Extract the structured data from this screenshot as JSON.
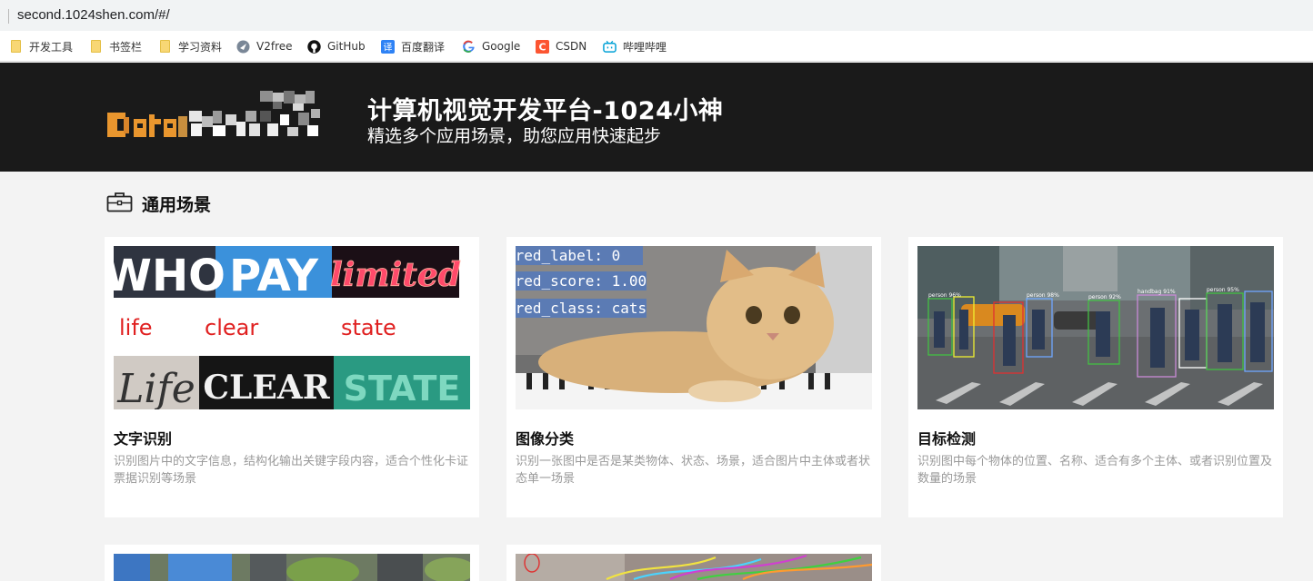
{
  "browser": {
    "url": "second.1024shen.com/#/",
    "bookmarks": [
      {
        "label": "开发工具",
        "icon": "folder-icon"
      },
      {
        "label": "书签栏",
        "icon": "folder-icon"
      },
      {
        "label": "学习资料",
        "icon": "folder-icon"
      },
      {
        "label": "V2free",
        "icon": "v2free-icon"
      },
      {
        "label": "GitHub",
        "icon": "github-icon"
      },
      {
        "label": "百度翻译",
        "icon": "baidu-translate-icon"
      },
      {
        "label": "Google",
        "icon": "google-icon"
      },
      {
        "label": "CSDN",
        "icon": "csdn-icon"
      },
      {
        "label": "哔哩哔哩",
        "icon": "bilibili-icon"
      }
    ]
  },
  "header": {
    "title": "计算机视觉开发平台-1024小神",
    "subtitle": "精选多个应用场景，助您应用快速起步",
    "logo_icon": "pixelated-logo"
  },
  "section": {
    "title": "通用场景",
    "icon": "briefcase-icon"
  },
  "cards": [
    {
      "title": "文字识别",
      "desc": "识别图片中的文字信息，结构化输出关键字段内容，适合个性化卡证票据识别等场景",
      "image": {
        "words_top": [
          "WHO",
          "PAY",
          "limited"
        ],
        "words_mid": [
          "life",
          "clear",
          "state"
        ],
        "words_bot": [
          "Life",
          "CLEAR",
          "STATE"
        ]
      }
    },
    {
      "title": "图像分类",
      "desc": "识别一张图中是否是某类物体、状态、场景，适合图片中主体或者状态单一场景",
      "image": {
        "labels": [
          "pred_label: 0",
          "pred_score: 1.00",
          "pred_class: cats"
        ]
      }
    },
    {
      "title": "目标检测",
      "desc": "识别图中每个物体的位置、名称、适合有多个主体、或者识别位置及数量的场景",
      "image": {
        "box_labels": [
          "person 96%",
          "person 98%",
          "person 92%",
          "handbag 91%",
          "person 95%"
        ]
      }
    }
  ],
  "colors": {
    "banner_bg": "#1a1a1a",
    "page_bg": "#f3f3f3",
    "card_bg": "#ffffff",
    "desc_text": "#999999",
    "logo_orange": "#e9962e"
  }
}
